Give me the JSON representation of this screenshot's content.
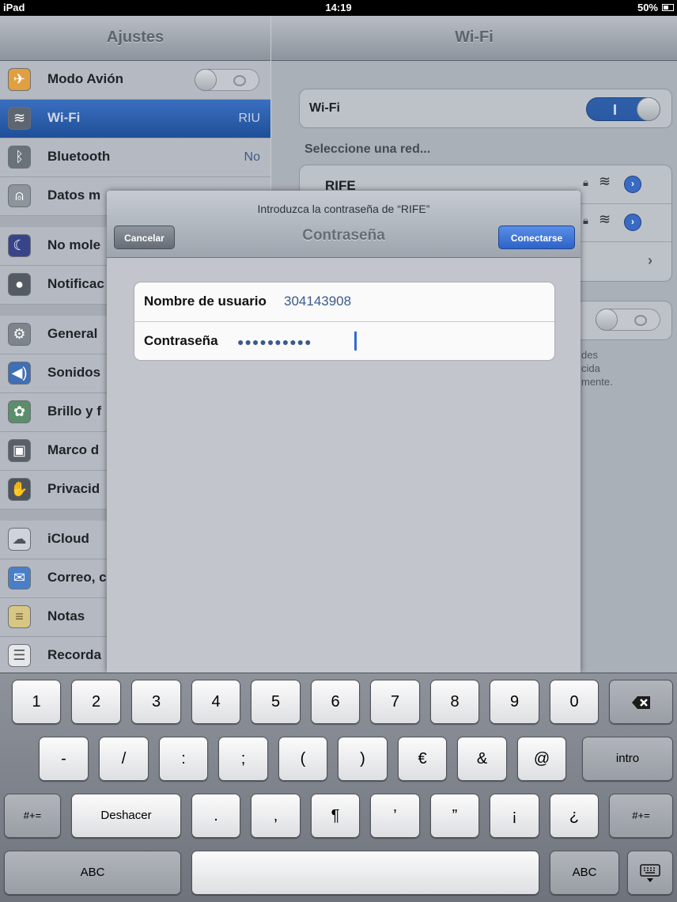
{
  "status_bar": {
    "device": "iPad",
    "time": "14:19",
    "battery": "50%"
  },
  "master": {
    "title": "Ajustes",
    "items": [
      {
        "label": "Modo Avión",
        "value": "",
        "icon": "airplane-icon"
      },
      {
        "label": "Wi-Fi",
        "value": "RIU",
        "icon": "wifi-icon"
      },
      {
        "label": "Bluetooth",
        "value": "No",
        "icon": "bluetooth-icon"
      },
      {
        "label": "Datos m",
        "value": "",
        "icon": "antenna-icon"
      },
      {
        "label": "No mole",
        "value": "",
        "icon": "moon-icon"
      },
      {
        "label": "Notificac",
        "value": "",
        "icon": "notifications-icon"
      },
      {
        "label": "General",
        "value": "",
        "icon": "gear-icon"
      },
      {
        "label": "Sonidos",
        "value": "",
        "icon": "speaker-icon"
      },
      {
        "label": "Brillo y f",
        "value": "",
        "icon": "flower-icon"
      },
      {
        "label": "Marco d",
        "value": "",
        "icon": "picture-frame-icon"
      },
      {
        "label": "Privacid",
        "value": "",
        "icon": "hand-icon"
      },
      {
        "label": "iCloud",
        "value": "",
        "icon": "cloud-icon"
      },
      {
        "label": "Correo, c",
        "value": "",
        "icon": "mail-icon"
      },
      {
        "label": "Notas",
        "value": "",
        "icon": "notes-icon"
      },
      {
        "label": "Recorda",
        "value": "",
        "icon": "reminders-icon"
      }
    ]
  },
  "detail": {
    "title": "Wi-Fi",
    "wifi_label": "Wi-Fi",
    "wifi_on_glyph": "I",
    "choose_network": "Seleccione una red...",
    "network_1": "RIFE",
    "partial_text_1": "des",
    "partial_text_2": "cida",
    "partial_text_3": "mente."
  },
  "sheet": {
    "prompt": "Introduzca la contraseña de “RIFE”",
    "title": "Contraseña",
    "cancel_label": "Cancelar",
    "connect_label": "Conectarse",
    "username_label": "Nombre de usuario",
    "username_value": "304143908",
    "password_label": "Contraseña",
    "password_mask": "●●●●●●●●●●"
  },
  "keyboard": {
    "row1": [
      "1",
      "2",
      "3",
      "4",
      "5",
      "6",
      "7",
      "8",
      "9",
      "0"
    ],
    "row2": [
      "-",
      "/",
      ":",
      ";",
      "(",
      ")",
      "€",
      "&",
      "@"
    ],
    "return_label": "intro",
    "row3_symbols_label": "#+=",
    "undo_label": "Deshacer",
    "row3": [
      ".",
      ",",
      "¶",
      "’",
      "”",
      "¡",
      "¿"
    ],
    "abc_label": "ABC"
  }
}
